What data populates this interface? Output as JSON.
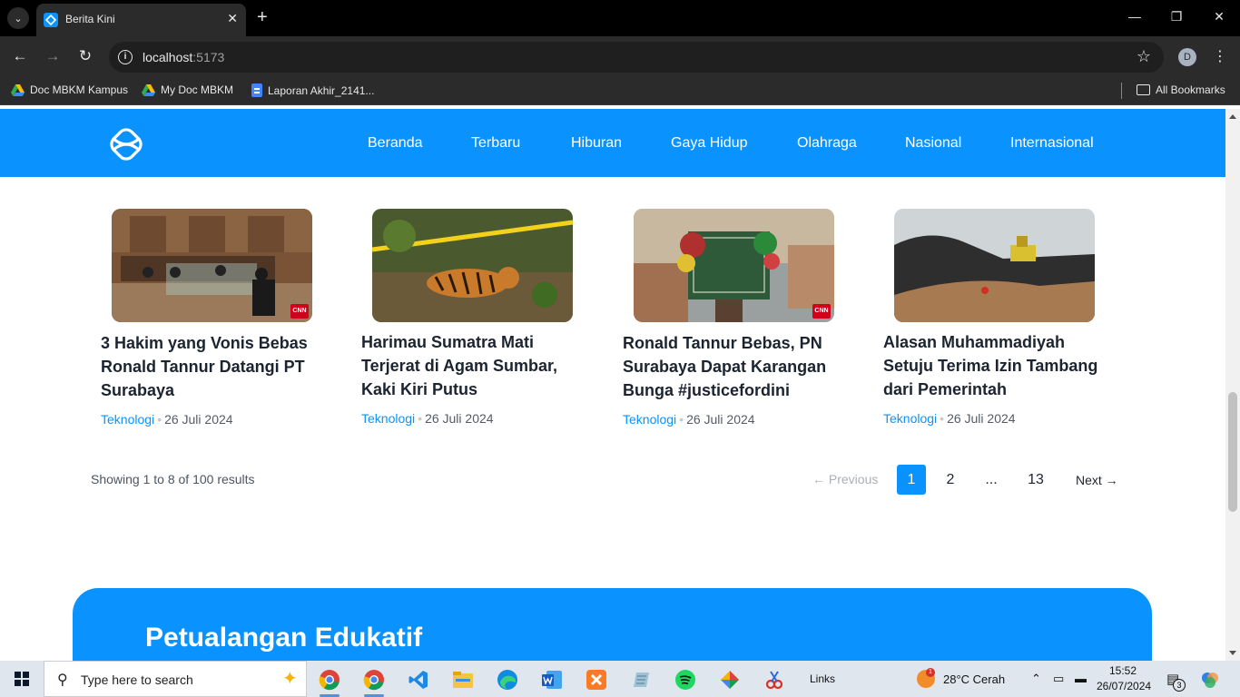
{
  "browser": {
    "tab_title": "Berita Kini",
    "url_host": "localhost",
    "url_port": ":5173",
    "profile_initial": "D",
    "bookmarks": [
      {
        "label": "Doc MBKM Kampus",
        "icon": "google-drive-icon"
      },
      {
        "label": "My Doc MBKM",
        "icon": "google-drive-icon"
      },
      {
        "label": "Laporan Akhir_2141...",
        "icon": "google-docs-icon"
      }
    ],
    "all_bookmarks": "All Bookmarks"
  },
  "site": {
    "brand_color": "#0a93ff",
    "nav": [
      "Beranda",
      "Terbaru",
      "Hiburan",
      "Gaya Hidup",
      "Olahraga",
      "Nasional",
      "Internasional"
    ]
  },
  "articles": [
    {
      "title": "3 Hakim yang Vonis Bebas Ronald Tannur Datangi PT Surabaya",
      "category": "Teknologi",
      "date": "26 Juli 2024",
      "image": "courtroom-photo",
      "badge": "CNN"
    },
    {
      "title": "Harimau Sumatra Mati Terjerat di Agam Sumbar, Kaki Kiri Putus",
      "category": "Teknologi",
      "date": "26 Juli 2024",
      "image": "tiger-photo",
      "badge": ""
    },
    {
      "title": "Ronald Tannur Bebas, PN Surabaya Dapat Karangan Bunga #justicefordini",
      "category": "Teknologi",
      "date": "26 Juli 2024",
      "image": "flower-board-photo",
      "badge": "CNN"
    },
    {
      "title": "Alasan Muhammadiyah Setuju Terima Izin Tambang dari Pemerintah",
      "category": "Teknologi",
      "date": "26 Juli 2024",
      "image": "mining-photo",
      "badge": ""
    }
  ],
  "pagination": {
    "showing": "Showing 1 to 8 of 100 results",
    "prev": "← Previous",
    "pages": [
      "1",
      "2",
      "...",
      "13"
    ],
    "active_page": "1",
    "next": "Next →"
  },
  "promo": {
    "title": "Petualangan Edukatif"
  },
  "taskbar": {
    "search_placeholder": "Type here to search",
    "links": "Links",
    "weather_badge": "1",
    "weather": "28°C  Cerah",
    "time": "15:52",
    "date": "26/07/2024",
    "notification_count": "3"
  }
}
